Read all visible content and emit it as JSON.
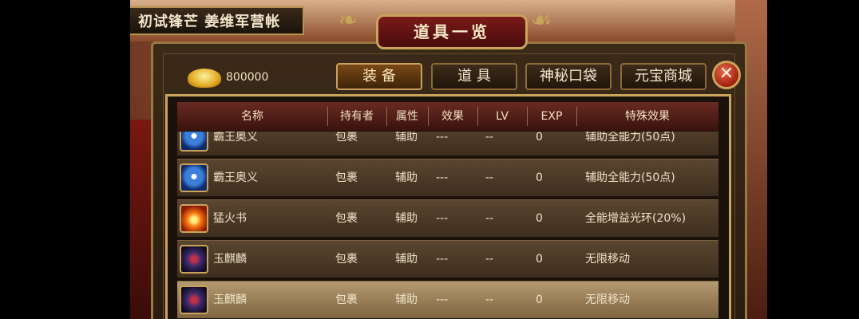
{
  "location": "初试锋芒 姜维军营帐",
  "window": {
    "title": "道具一览"
  },
  "gold": {
    "amount": "800000",
    "icon": "gold-ingot-icon"
  },
  "tabs": [
    {
      "label": "装 备",
      "active": true
    },
    {
      "label": "道 具",
      "active": false
    },
    {
      "label": "神秘口袋",
      "active": false
    },
    {
      "label": "元宝商城",
      "active": false
    }
  ],
  "close": {
    "label": "✕"
  },
  "table": {
    "headers": [
      "名称",
      "持有者",
      "属性",
      "效果",
      "LV",
      "EXP",
      "特殊效果"
    ],
    "rows": [
      {
        "icon": "blue-orb-icon",
        "name": "霸王奥义",
        "holder": "包裹",
        "attr": "辅助",
        "effect": "---",
        "lv": "--",
        "exp": "0",
        "special": "辅助全能力(50点)"
      },
      {
        "icon": "blue-orb-icon",
        "name": "霸王奥义",
        "holder": "包裹",
        "attr": "辅助",
        "effect": "---",
        "lv": "--",
        "exp": "0",
        "special": "辅助全能力(50点)"
      },
      {
        "icon": "fire-book-icon",
        "name": "猛火书",
        "holder": "包裹",
        "attr": "辅助",
        "effect": "---",
        "lv": "--",
        "exp": "0",
        "special": "全能增益光环(20%)"
      },
      {
        "icon": "kylin-icon",
        "name": "玉麒麟",
        "holder": "包裹",
        "attr": "辅助",
        "effect": "---",
        "lv": "--",
        "exp": "0",
        "special": "无限移动"
      },
      {
        "icon": "kylin-icon",
        "name": "玉麒麟",
        "holder": "包裹",
        "attr": "辅助",
        "effect": "---",
        "lv": "--",
        "exp": "0",
        "special": "无限移动"
      }
    ]
  },
  "colors": {
    "gold_trim": "#c9a45a",
    "header_red": "#6a2a22",
    "row_brown": "#5a4630",
    "selected_row": "#b49a70"
  }
}
